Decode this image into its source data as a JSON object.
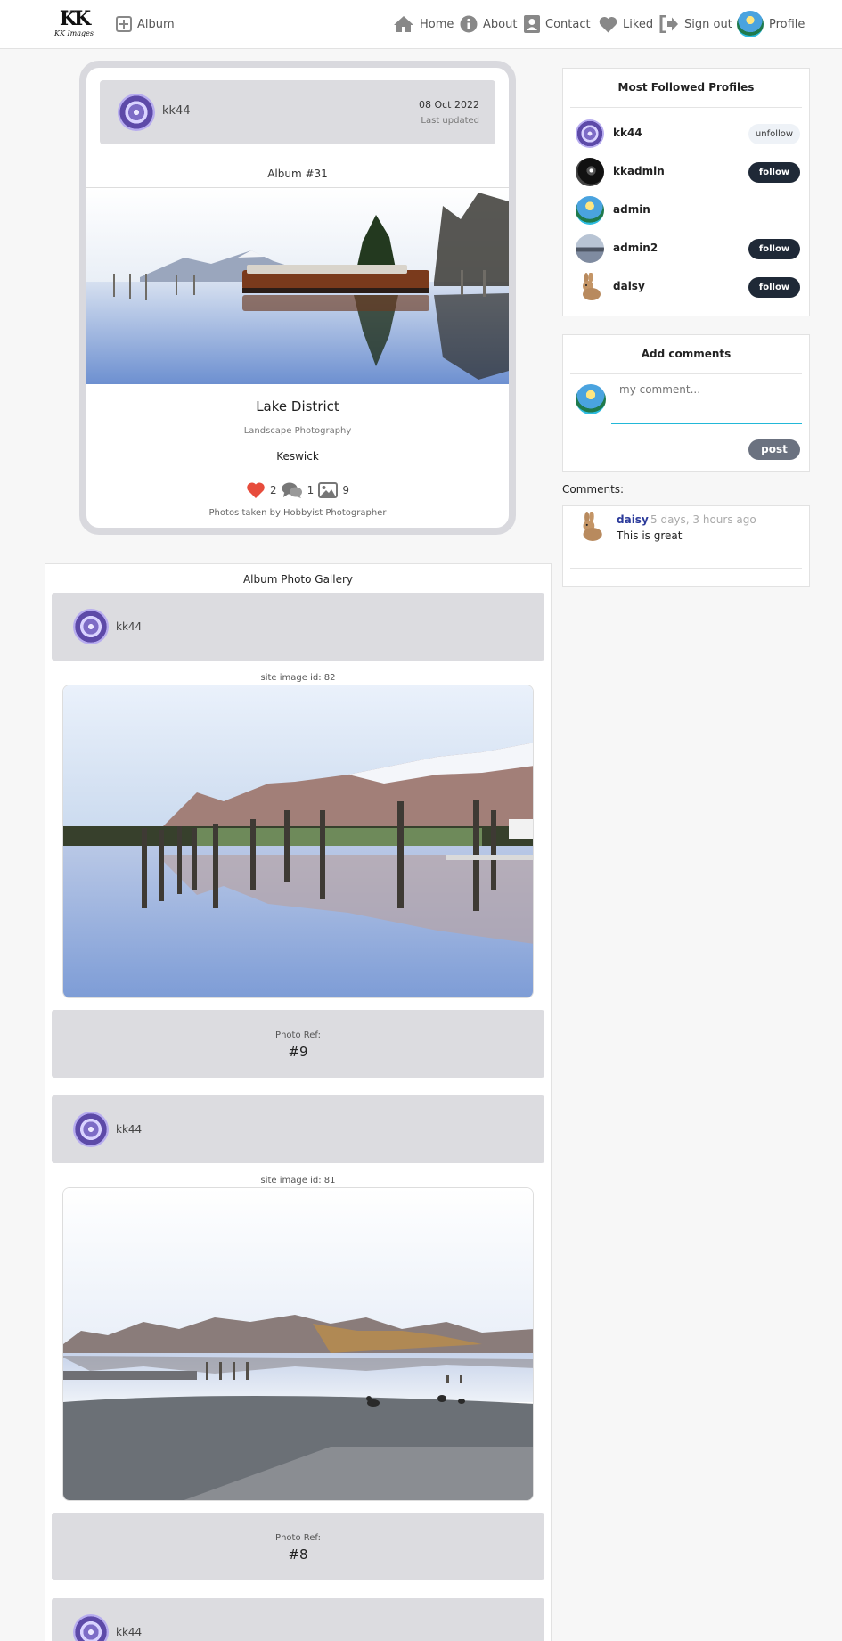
{
  "nav": {
    "logo_text": "KK Images",
    "logo_small": "IMAGES",
    "logo_mark": "KK",
    "add_album": "Album",
    "home": "Home",
    "about": "About",
    "contact": "Contact",
    "liked": "Liked",
    "sign_out": "Sign out",
    "profile": "Profile"
  },
  "album": {
    "username": "kk44",
    "date": "08 Oct 2022",
    "updated_label": "Last updated",
    "number": "Album #31",
    "title": "Lake District",
    "category": "Landscape Photography",
    "location": "Keswick",
    "likes": "2",
    "comments": "1",
    "photos": "9",
    "credit": "Photos taken by Hobbyist Photographer"
  },
  "gallery": {
    "title": "Album Photo Gallery",
    "photos": [
      {
        "username": "kk44",
        "site_id": "site image id: 82",
        "ref_label": "Photo Ref:",
        "ref": "#9"
      },
      {
        "username": "kk44",
        "site_id": "site image id: 81",
        "ref_label": "Photo Ref:",
        "ref": "#8"
      },
      {
        "username": "kk44"
      }
    ]
  },
  "most_followed": {
    "title": "Most Followed Profiles",
    "profiles": [
      {
        "name": "kk44",
        "action": "unfollow"
      },
      {
        "name": "kkadmin",
        "action": "follow"
      },
      {
        "name": "admin",
        "action": ""
      },
      {
        "name": "admin2",
        "action": "follow"
      },
      {
        "name": "daisy",
        "action": "follow"
      }
    ]
  },
  "add_comment": {
    "title": "Add comments",
    "placeholder": "my comment...",
    "post_label": "post"
  },
  "comments": {
    "label": "Comments:",
    "items": [
      {
        "user": "daisy",
        "time": "5 days, 3 hours ago",
        "text": "This is great"
      }
    ]
  },
  "colors": {
    "follow_button": "#1f2937",
    "unfollow_button": "#eef2f7",
    "post_button": "#6b7280",
    "heart": "#e74c3c",
    "input_underline": "#22b8d8",
    "comment_user": "#2b3a9a"
  }
}
